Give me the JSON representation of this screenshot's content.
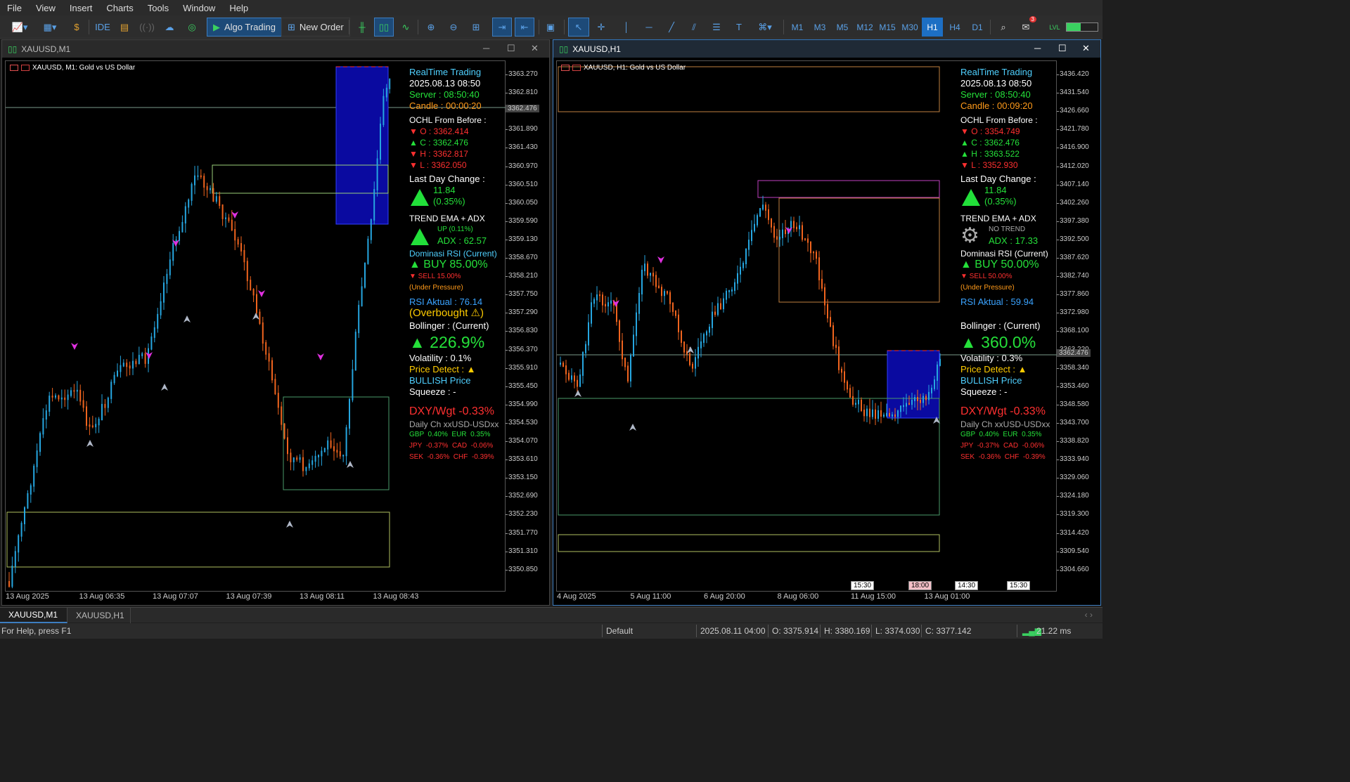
{
  "menu": [
    "File",
    "View",
    "Insert",
    "Charts",
    "Tools",
    "Window",
    "Help"
  ],
  "toolbar": {
    "ide": "IDE",
    "algo_trading": "Algo Trading",
    "new_order": "New Order",
    "timeframes": [
      "M1",
      "M3",
      "M5",
      "M12",
      "M15",
      "M30",
      "H1",
      "H4",
      "D1"
    ],
    "active_timeframe": "H1",
    "notification_count": "3"
  },
  "left": {
    "title": "XAUUSD,M1",
    "symbol_header": "XAUUSD, M1:  Gold vs US Dollar",
    "y_ticks": [
      "3363.270",
      "3362.810",
      "3362.350",
      "3361.890",
      "3361.430",
      "3360.970",
      "3360.510",
      "3360.050",
      "3359.590",
      "3359.130",
      "3358.670",
      "3358.210",
      "3357.750",
      "3357.290",
      "3356.830",
      "3356.370",
      "3355.910",
      "3355.450",
      "3354.990",
      "3354.530",
      "3354.070",
      "3353.610",
      "3353.150",
      "3352.690",
      "3352.230",
      "3351.770",
      "3351.310",
      "3350.850"
    ],
    "price_tag": "3362.476",
    "x_ticks": [
      "13 Aug 2025",
      "13 Aug 06:35",
      "13 Aug 07:07",
      "13 Aug 07:39",
      "13 Aug 08:11",
      "13 Aug 08:43"
    ],
    "panel": {
      "rt_title": "RealTime Trading",
      "datetime": "2025.08.13 08:50",
      "server": "Server : 08:50:40",
      "candle": "Candle : 00:00:20",
      "ohcl_title": "OCHL From Before :",
      "o": "▼ O : 3362.414",
      "c": "▲ C : 3362.476",
      "h": "▼ H : 3362.817",
      "l": "▼ L : 3362.050",
      "ldc_title": "Last Day Change :",
      "ldc_value": "11.84",
      "ldc_pct": "(0.35%)",
      "trend_title": "TREND EMA + ADX",
      "trend_status": "UP (0.11%)",
      "adx": "ADX : 62.57",
      "rsi_dom_title": "Dominasi RSI (Current)",
      "buy": "▲ BUY 85.00%",
      "sell": "▼ SELL 15.00%",
      "pressure": "(Under Pressure)",
      "rsi_actual": "RSI Aktual : 76.14",
      "overbought": "(Overbought ⚠)",
      "boll_title": "Bollinger : (Current)",
      "boll_value": "▲ 226.9%",
      "volatility": "Volatility : 0.1%",
      "price_detect": "Price Detect : ▲",
      "bullish": "BULLISH Price",
      "squeeze": "Squeeze : -",
      "dxy": "DXY/Wgt -0.33%",
      "daily": "Daily Ch xxUSD-USDxx",
      "fx1": "GBP  0.40%  EUR  0.35%",
      "fx2": "JPY  -0.37%  CAD  -0.06%",
      "fx3": "SEK  -0.36%  CHF  -0.39%"
    }
  },
  "right": {
    "title": "XAUUSD,H1",
    "symbol_header": "XAUUSD, H1:  Gold vs US Dollar",
    "y_ticks": [
      "3436.420",
      "3431.540",
      "3426.660",
      "3421.780",
      "3416.900",
      "3412.020",
      "3407.140",
      "3402.260",
      "3397.380",
      "3392.500",
      "3387.620",
      "3382.740",
      "3377.860",
      "3372.980",
      "3368.100",
      "3363.220",
      "3358.340",
      "3353.460",
      "3348.580",
      "3343.700",
      "3338.820",
      "3333.940",
      "3329.060",
      "3324.180",
      "3319.300",
      "3314.420",
      "3309.540",
      "3304.660"
    ],
    "price_tag": "3362.476",
    "x_ticks": [
      "4 Aug 2025",
      "5 Aug 11:00",
      "6 Aug 20:00",
      "8 Aug 06:00",
      "11 Aug 15:00",
      "13 Aug 01:00"
    ],
    "time_labels": [
      "15:30",
      "18:00",
      "14:30",
      "15:30"
    ],
    "panel": {
      "rt_title": "RealTime Trading",
      "datetime": "2025.08.13 08:50",
      "server": "Server : 08:50:40",
      "candle": "Candle : 00:09:20",
      "ohcl_title": "OCHL From Before :",
      "o": "▼ O : 3354.749",
      "c": "▲ C : 3362.476",
      "h": "▲ H : 3363.522",
      "l": "▼ L : 3352.930",
      "ldc_title": "Last Day Change :",
      "ldc_value": "11.84",
      "ldc_pct": "(0.35%)",
      "trend_title": "TREND EMA + ADX",
      "trend_status": "NO TREND",
      "adx": "ADX : 17.33",
      "rsi_dom_title": "Dominasi RSI (Current)",
      "buy": "▲ BUY 50.00%",
      "sell": "▼ SELL 50.00%",
      "pressure": "(Under Pressure)",
      "rsi_actual": "RSI Aktual : 59.94",
      "boll_title": "Bollinger : (Current)",
      "boll_value": "▲ 360.0%",
      "volatility": "Volatility : 0.3%",
      "price_detect": "Price Detect : ▲",
      "bullish": "BULLISH Price",
      "squeeze": "Squeeze : -",
      "dxy": "DXY/Wgt -0.33%",
      "daily": "Daily Ch xxUSD-USDxx",
      "fx1": "GBP  0.40%  EUR  0.35%",
      "fx2": "JPY  -0.37%  CAD  -0.06%",
      "fx3": "SEK  -0.36%  CHF  -0.39%"
    }
  },
  "tabs": [
    "XAUUSD,M1",
    "XAUUSD,H1"
  ],
  "status": {
    "help": "For Help, press F1",
    "profile": "Default",
    "datetime": "2025.08.11 04:00",
    "o": "O: 3375.914",
    "h": "H: 3380.169",
    "l": "L: 3374.030",
    "c": "C: 3377.142",
    "ping": "21.22 ms"
  },
  "colors": {
    "bull": "#26a6e0",
    "bear": "#f0641e",
    "green": "#25e03a",
    "red": "#ff3030"
  }
}
